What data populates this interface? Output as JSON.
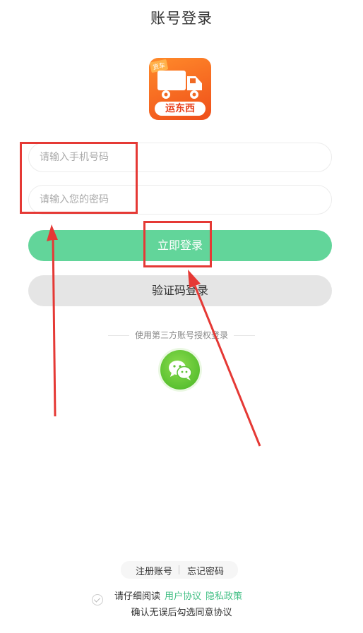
{
  "header": {
    "title": "账号登录"
  },
  "logo": {
    "tag": "货车",
    "brand": "运东西"
  },
  "form": {
    "phone_placeholder": "请输入手机号码",
    "password_placeholder": "请输入您的密码",
    "login_label": "立即登录",
    "code_login_label": "验证码登录"
  },
  "third_party": {
    "label": "使用第三方账号授权登录",
    "icon": "wechat-icon"
  },
  "footer": {
    "register": "注册账号",
    "forgot": "忘记密码",
    "agree_prefix": "请仔细阅读",
    "user_agreement": "用户协议",
    "privacy_policy": "隐私政策",
    "confirm_text": "确认无误后勾选同意协议"
  },
  "colors": {
    "primary": "#62d59a",
    "link": "#41bf84",
    "annotation": "#e53935"
  }
}
